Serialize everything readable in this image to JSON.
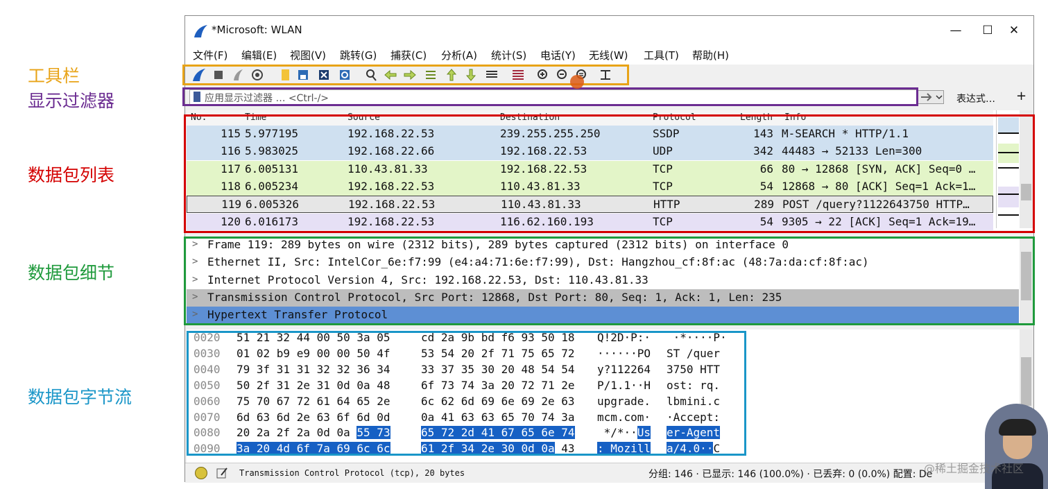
{
  "annotations": {
    "toolbar": "工具栏",
    "display_filter": "显示过滤器",
    "packet_list": "数据包列表",
    "packet_details": "数据包细节",
    "packet_bytes": "数据包字节流",
    "colors": {
      "toolbar": "#e8a317",
      "filter": "#6b2c91",
      "list": "#d40000",
      "details": "#1f9a3c",
      "bytes": "#1a96c8"
    }
  },
  "window": {
    "title": "*Microsoft: WLAN",
    "minimize": "—",
    "maximize": "☐",
    "close": "✕"
  },
  "menu": [
    "文件(F)",
    "编辑(E)",
    "视图(V)",
    "跳转(G)",
    "捕获(C)",
    "分析(A)",
    "统计(S)",
    "电话(Y)",
    "无线(W)",
    "工具(T)",
    "帮助(H)"
  ],
  "toolbar_icons": [
    "shark-fin-icon",
    "stop-icon",
    "restart-icon",
    "options-icon",
    "open-file-icon",
    "save-icon",
    "close-file-icon",
    "reload-icon",
    "find-icon",
    "back-icon",
    "forward-icon",
    "go-to-packet-icon",
    "first-packet-icon",
    "last-packet-icon",
    "autoscroll-icon",
    "colorize-icon",
    "zoom-in-icon",
    "zoom-out-icon",
    "zoom-normal-icon",
    "resize-columns-icon"
  ],
  "filter": {
    "placeholder": "应用显示过滤器 … <Ctrl-/>",
    "expression_label": "表达式…",
    "plus_label": "+"
  },
  "packet_list": {
    "columns": [
      "No.",
      "Time",
      "Source",
      "Destination",
      "Protocol",
      "Length",
      "Info"
    ],
    "rows": [
      {
        "no": "115",
        "time": "5.977195",
        "src": "192.168.22.53",
        "dst": "239.255.255.250",
        "proto": "SSDP",
        "len": "143",
        "info": "M-SEARCH * HTTP/1.1",
        "bg": "#cfe0f0"
      },
      {
        "no": "116",
        "time": "5.983025",
        "src": "192.168.22.66",
        "dst": "192.168.22.53",
        "proto": "UDP",
        "len": "342",
        "info": "44483 → 52133 Len=300",
        "bg": "#cfe0f0"
      },
      {
        "no": "117",
        "time": "6.005131",
        "src": "110.43.81.33",
        "dst": "192.168.22.53",
        "proto": "TCP",
        "len": "66",
        "info": "80 → 12868 [SYN, ACK] Seq=0 …",
        "bg": "#e3f5c8"
      },
      {
        "no": "118",
        "time": "6.005234",
        "src": "192.168.22.53",
        "dst": "110.43.81.33",
        "proto": "TCP",
        "len": "54",
        "info": "12868 → 80 [ACK] Seq=1 Ack=1…",
        "bg": "#e3f5c8"
      },
      {
        "no": "119",
        "time": "6.005326",
        "src": "192.168.22.53",
        "dst": "110.43.81.33",
        "proto": "HTTP",
        "len": "289",
        "info": "POST /query?1122643750 HTTP…",
        "bg": "#e6e6e6"
      },
      {
        "no": "120",
        "time": "6.016173",
        "src": "192.168.22.53",
        "dst": "116.62.160.193",
        "proto": "TCP",
        "len": "54",
        "info": "9305 → 22 [ACK] Seq=1 Ack=19…",
        "bg": "#e6e0f5"
      }
    ]
  },
  "details": [
    {
      "text": "Frame 119: 289 bytes on wire (2312 bits), 289 bytes captured (2312 bits) on interface 0",
      "bg": "#ffffff",
      "color": "#111111"
    },
    {
      "text": "Ethernet II, Src: IntelCor_6e:f7:99 (e4:a4:71:6e:f7:99), Dst: Hangzhou_cf:8f:ac (48:7a:da:cf:8f:ac)",
      "bg": "#ffffff",
      "color": "#111111"
    },
    {
      "text": "Internet Protocol Version 4, Src: 192.168.22.53, Dst: 110.43.81.33",
      "bg": "#ffffff",
      "color": "#111111"
    },
    {
      "text": "Transmission Control Protocol, Src Port: 12868, Dst Port: 80, Seq: 1, Ack: 1, Len: 235",
      "bg": "#bdbdbd",
      "color": "#111111"
    },
    {
      "text": "Hypertext Transfer Protocol",
      "bg": "#5d8fd4",
      "color": "#111111"
    }
  ],
  "bytes": [
    {
      "off": "0020",
      "hexA": "51 21 32 44 00 50 3a 05",
      "hexB": "cd 2a 9b bd f6 93 50 18",
      "ascA": "Q!2D·P:·",
      "ascB": " ·*····P·"
    },
    {
      "off": "0030",
      "hexA": "01 02 b9 e9 00 00 50 4f",
      "hexB": "53 54 20 2f 71 75 65 72",
      "ascA": "······PO",
      "ascB": "ST /quer"
    },
    {
      "off": "0040",
      "hexA": "79 3f 31 31 32 32 36 34",
      "hexB": "33 37 35 30 20 48 54 54",
      "ascA": "y?112264",
      "ascB": "3750 HTT"
    },
    {
      "off": "0050",
      "hexA": "50 2f 31 2e 31 0d 0a 48",
      "hexB": "6f 73 74 3a 20 72 71 2e",
      "ascA": "P/1.1··H",
      "ascB": "ost: rq."
    },
    {
      "off": "0060",
      "hexA": "75 70 67 72 61 64 65 2e",
      "hexB": "6c 62 6d 69 6e 69 2e 63",
      "ascA": "upgrade.",
      "ascB": "lbmini.c"
    },
    {
      "off": "0070",
      "hexA": "6d 63 6d 2e 63 6f 6d 0d",
      "hexB": "0a 41 63 63 65 70 74 3a",
      "ascA": "mcm.com·",
      "ascB": "·Accept:"
    },
    {
      "off": "0080",
      "hexA": "20 2a 2f 2a 0d 0a",
      "hexAsel": "55 73",
      "hexB": "65 72 2d 41 67 65 6e 74",
      "ascA": " */*··",
      "ascAsel": "Us",
      "ascB": "er-Agent"
    },
    {
      "off": "0090",
      "hexA": "",
      "hexAsel": "3a 20 4d 6f 7a 69 6c 6c",
      "hexB": "61 2f 34 2e 30 0d 0a",
      "hexBtail": "43",
      "ascA": "",
      "ascAsel": ": Mozill",
      "ascB": "a/4.0··",
      "ascBtail": "C"
    }
  ],
  "status": {
    "text": "Transmission Control Protocol (tcp), 20 bytes",
    "stats": "分组: 146 · 已显示: 146 (100.0%) · 已丢弃: 0 (0.0%)  配置: De"
  },
  "watermark": "@稀土掘金技术社区"
}
